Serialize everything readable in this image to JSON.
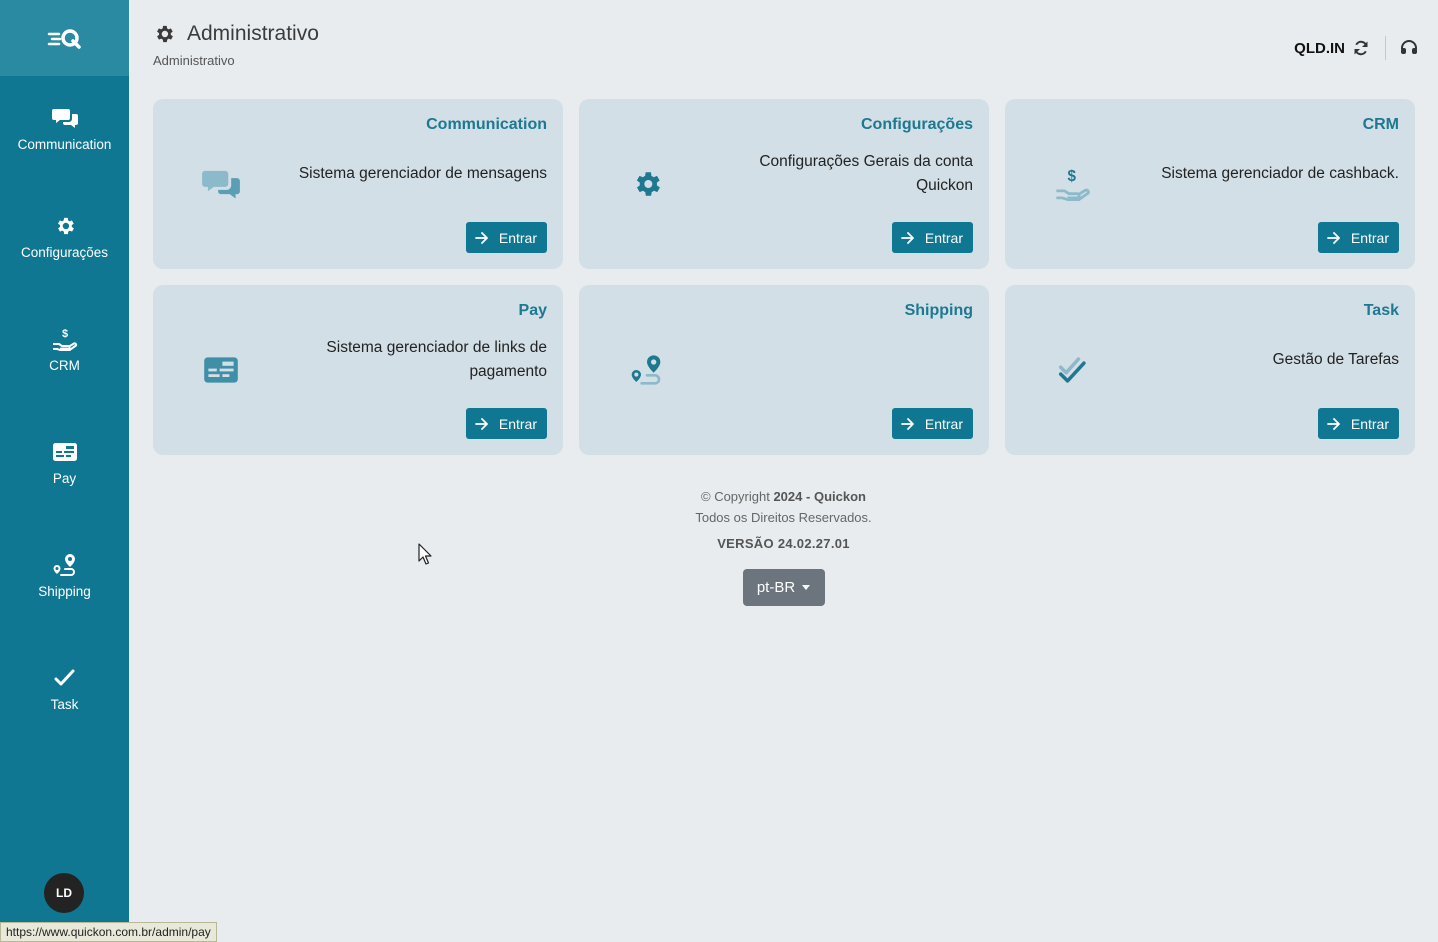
{
  "sidebar": {
    "logo": "quickon-logo",
    "items": [
      {
        "label": "Communication",
        "icon": "chat-bubbles-icon"
      },
      {
        "label": "Configurações",
        "icon": "gear-icon"
      },
      {
        "label": "CRM",
        "icon": "hand-dollar-icon"
      },
      {
        "label": "Pay",
        "icon": "credit-card-icon"
      },
      {
        "label": "Shipping",
        "icon": "route-pin-icon"
      },
      {
        "label": "Task",
        "icon": "double-check-icon"
      }
    ],
    "avatar_initials": "LD"
  },
  "header": {
    "title": "Administrativo",
    "breadcrumb": "Administrativo",
    "account_code": "QLD.IN"
  },
  "cards": [
    {
      "title": "Communication",
      "description": "Sistema gerenciador de mensagens",
      "button": "Entrar",
      "icon": "chat-bubbles-icon"
    },
    {
      "title": "Configurações",
      "description": "Configurações Gerais da conta Quickon",
      "button": "Entrar",
      "icon": "gear-icon"
    },
    {
      "title": "CRM",
      "description": "Sistema gerenciador de cashback.",
      "button": "Entrar",
      "icon": "hand-dollar-icon"
    },
    {
      "title": "Pay",
      "description": "Sistema gerenciador de links de pagamento",
      "button": "Entrar",
      "icon": "credit-card-icon"
    },
    {
      "title": "Shipping",
      "description": "",
      "button": "Entrar",
      "icon": "route-pin-icon"
    },
    {
      "title": "Task",
      "description": "Gestão de Tarefas",
      "button": "Entrar",
      "icon": "double-check-icon"
    }
  ],
  "footer": {
    "copyright_prefix": "© Copyright",
    "year": "2024",
    "separator": "-",
    "company": "Quickon",
    "rights": "Todos os Direitos Reservados.",
    "version": "VERSÃO 24.02.27.01",
    "language": "pt-BR"
  },
  "status_url": "https://www.quickon.com.br/admin/pay",
  "colors": {
    "sidebar": "#0f7791",
    "accent": "#1d7890",
    "card_bg": "#d3dfe6",
    "page_bg": "#e8ecef",
    "icon_muted": "#6aa7bb"
  }
}
